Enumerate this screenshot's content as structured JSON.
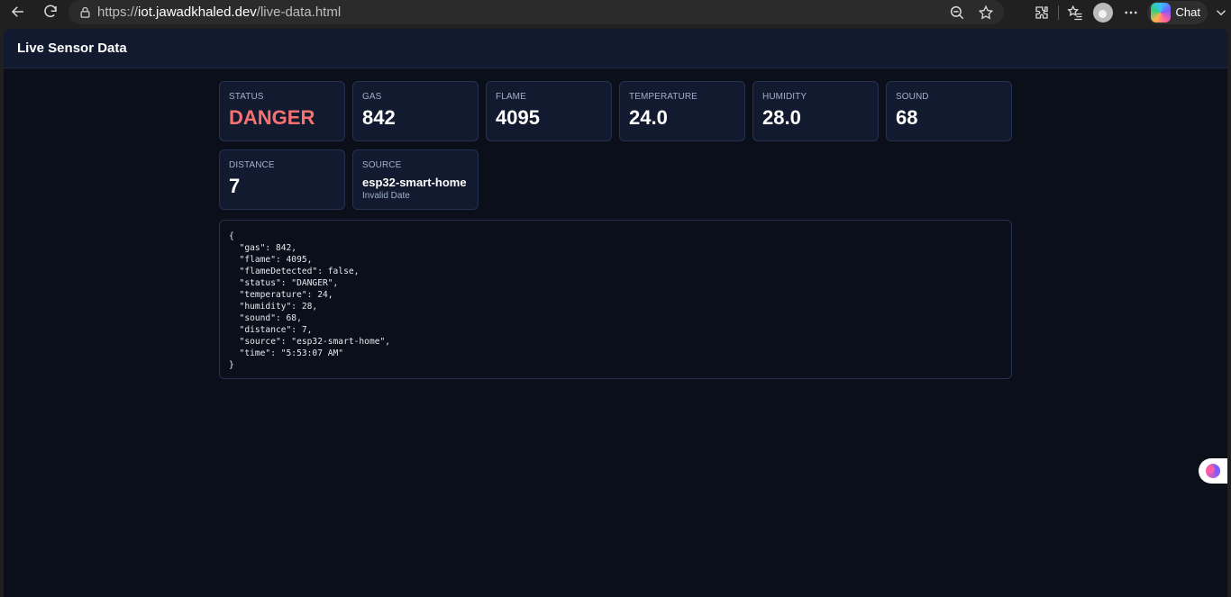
{
  "browser": {
    "url_prefix": "https://",
    "url_host": "iot.jawadkhaled.dev",
    "url_path": "/live-data.html",
    "copilot_label": "Chat"
  },
  "page": {
    "title": "Live Sensor Data"
  },
  "cards": {
    "status": {
      "label": "STATUS",
      "value": "DANGER"
    },
    "gas": {
      "label": "GAS",
      "value": "842"
    },
    "flame": {
      "label": "FLAME",
      "value": "4095"
    },
    "temperature": {
      "label": "TEMPERATURE",
      "value": "24.0"
    },
    "humidity": {
      "label": "HUMIDITY",
      "value": "28.0"
    },
    "sound": {
      "label": "SOUND",
      "value": "68"
    },
    "distance": {
      "label": "DISTANCE",
      "value": "7"
    },
    "source": {
      "label": "SOURCE",
      "value": "esp32-smart-home",
      "sub": "Invalid Date"
    }
  },
  "raw_json": "{\n  \"gas\": 842,\n  \"flame\": 4095,\n  \"flameDetected\": false,\n  \"status\": \"DANGER\",\n  \"temperature\": 24,\n  \"humidity\": 28,\n  \"sound\": 68,\n  \"distance\": 7,\n  \"source\": \"esp32-smart-home\",\n  \"time\": \"5:53:07 AM\"\n}",
  "colors": {
    "danger": "#f87171",
    "card_bg": "#111a2e",
    "page_bg": "#0b0f1a"
  }
}
